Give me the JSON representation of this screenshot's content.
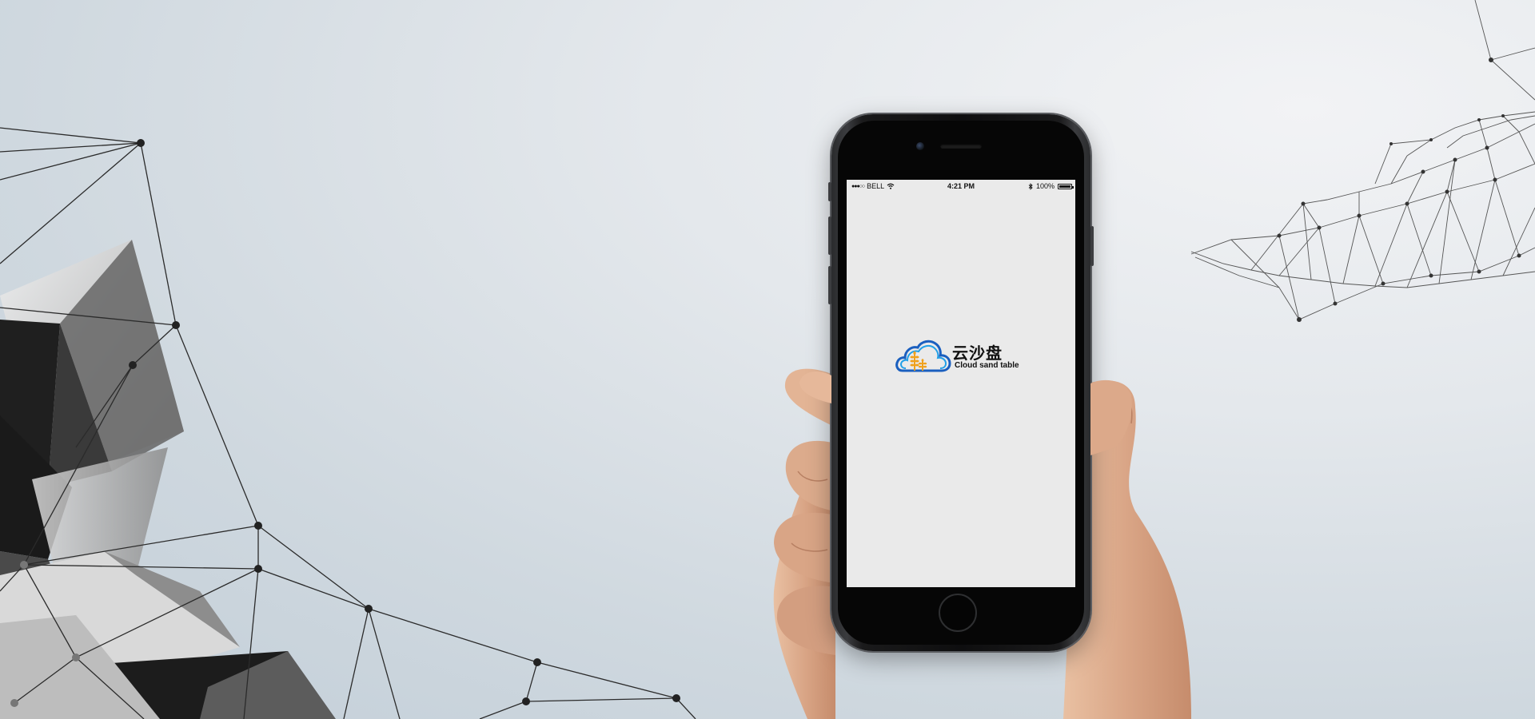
{
  "status_bar": {
    "carrier": "BELL",
    "time": "4:21 PM",
    "battery_text": "100%"
  },
  "app": {
    "name_cn": "云沙盘",
    "name_en": "Cloud sand table",
    "logo_colors": {
      "cloud_outer": "#1a5fbf",
      "cloud_inner": "#22a0e8",
      "wheat": "#f0a11c"
    }
  },
  "icons": [
    "signal-dots-icon",
    "wifi-icon",
    "bluetooth-icon",
    "battery-icon"
  ]
}
